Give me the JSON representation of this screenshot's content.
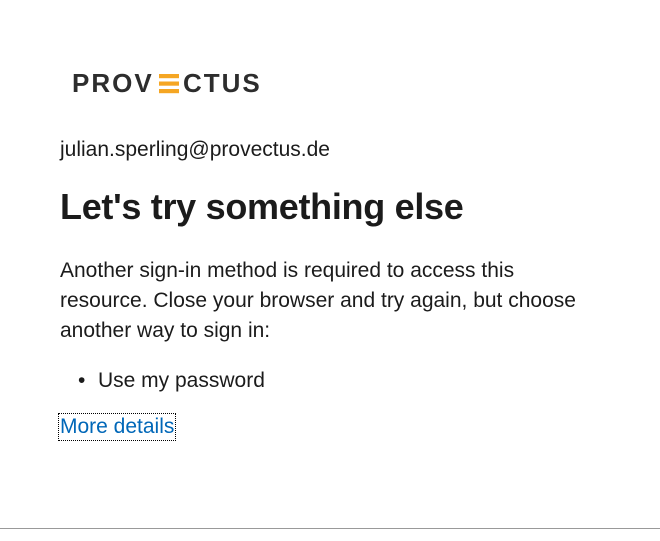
{
  "logo": {
    "name": "PROVECTUS",
    "accent_color": "#f5a623",
    "text_color": "#2d2d2d"
  },
  "email": "julian.sperling@provectus.de",
  "title": "Let's try something else",
  "message": "Another sign-in method is required to access this resource. Close your browser and try again, but choose another way to sign in:",
  "options": [
    "Use my password"
  ],
  "more_link": "More details",
  "link_color": "#0067b8"
}
